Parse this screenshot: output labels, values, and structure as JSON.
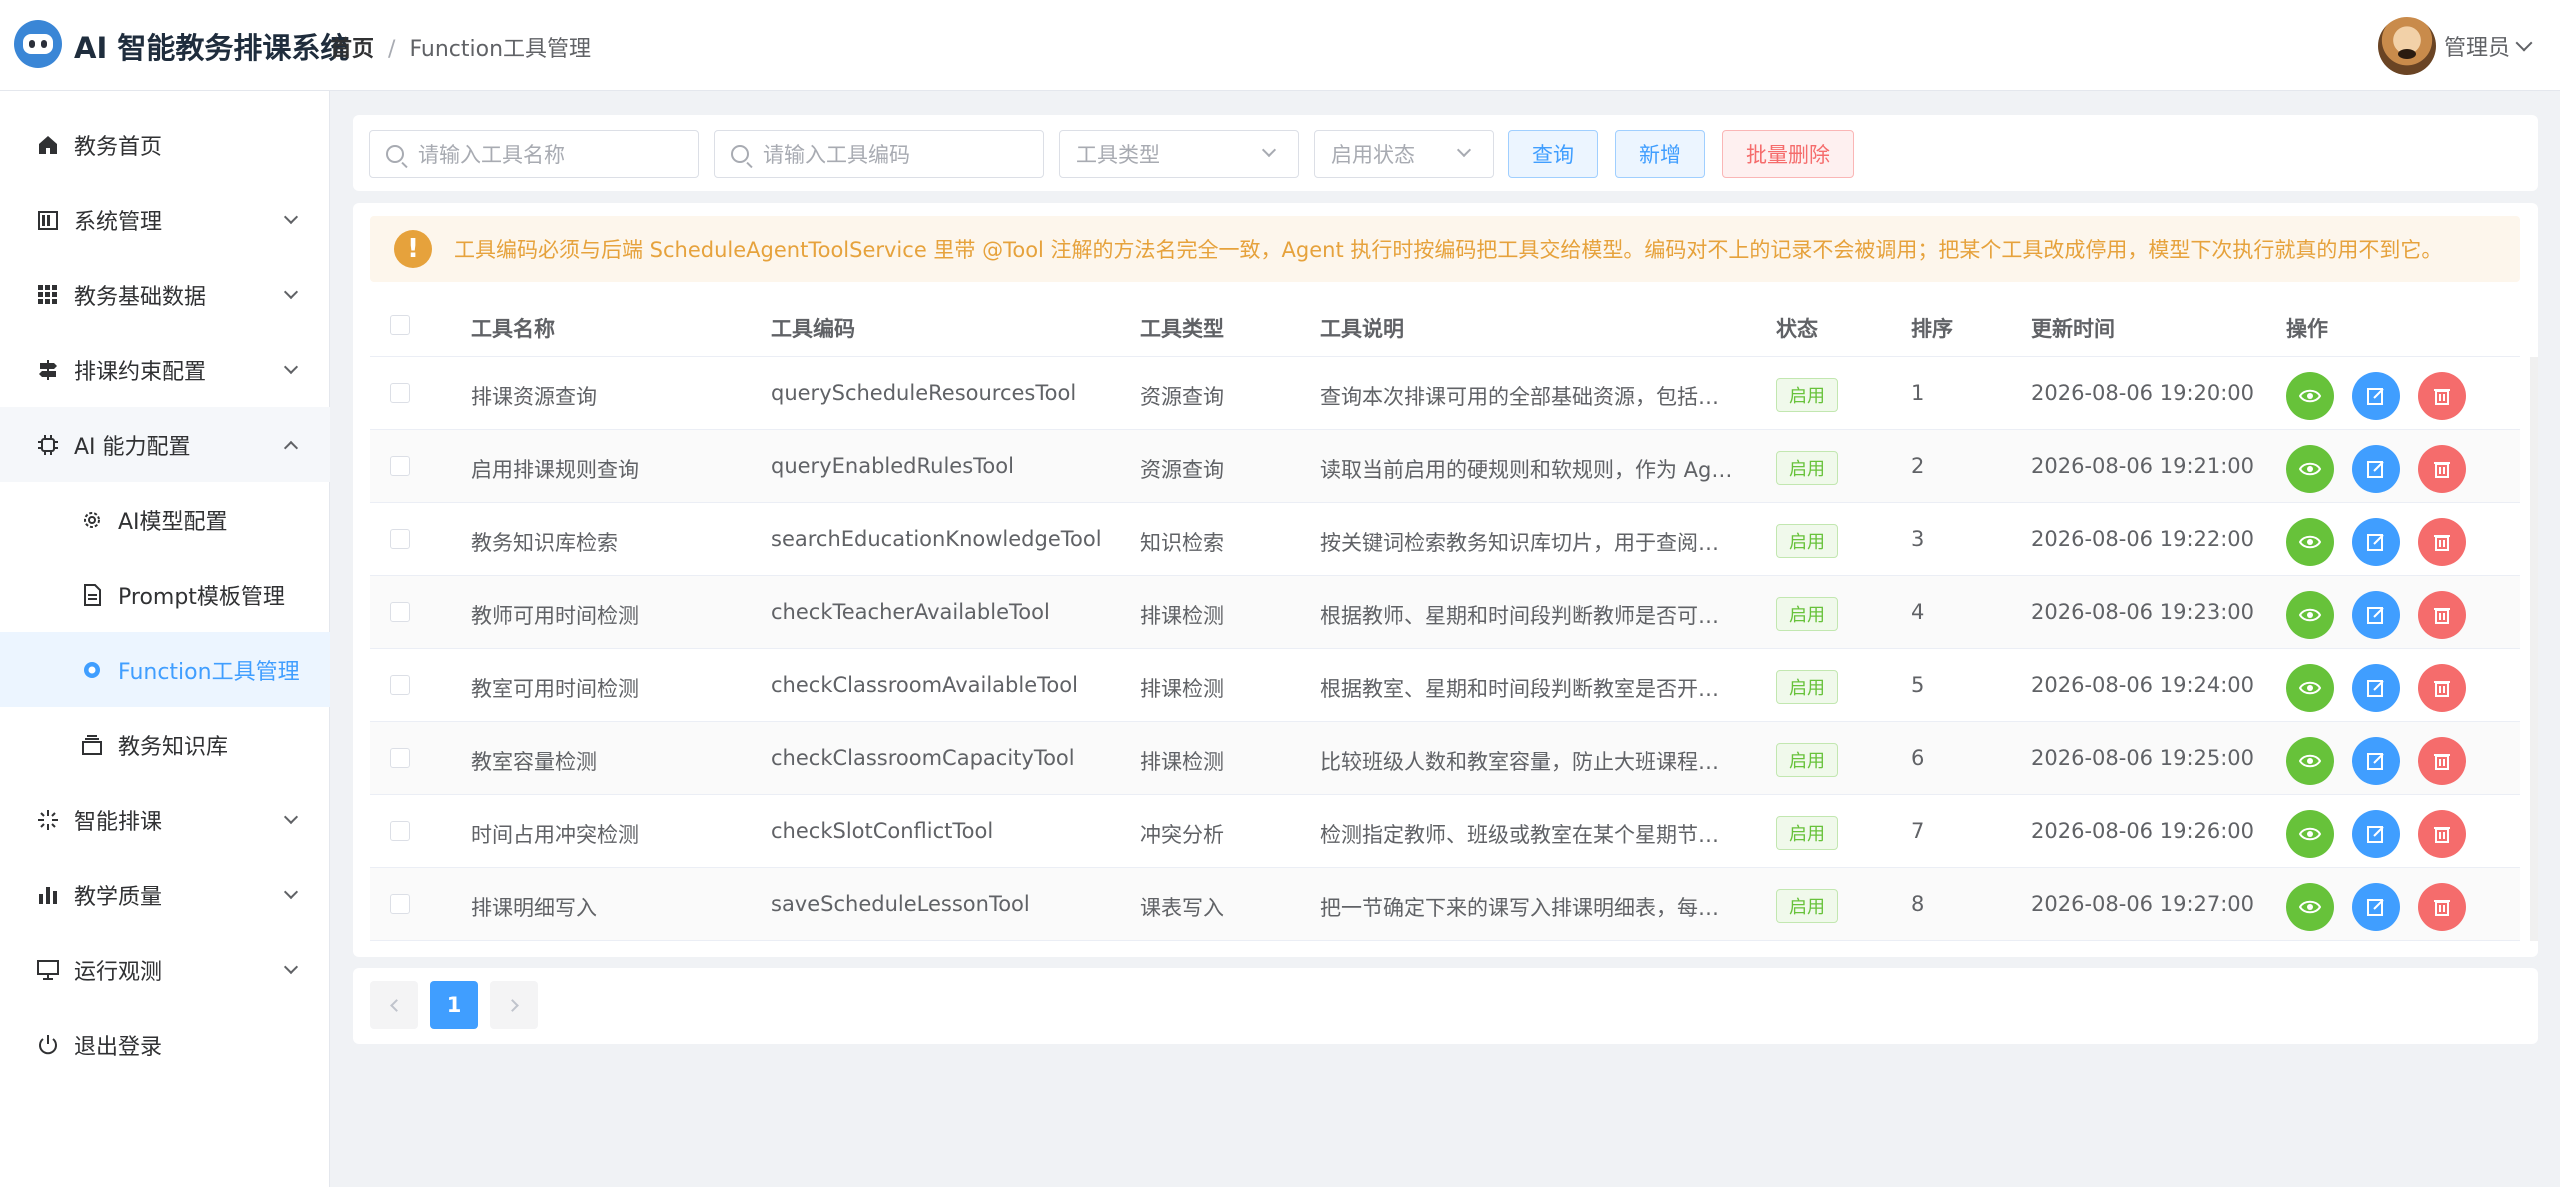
{
  "header": {
    "app_title": "AI 智能教务排课系统",
    "breadcrumb": [
      "首页",
      "Function工具管理"
    ],
    "breadcrumb_sep": "/",
    "user_name": "管理员"
  },
  "sidebar": {
    "items": [
      {
        "label": "教务首页",
        "icon": "home-icon"
      },
      {
        "label": "系统管理",
        "icon": "system-icon"
      },
      {
        "label": "教务基础数据",
        "icon": "grid-icon"
      },
      {
        "label": "排课约束配置",
        "icon": "signpost-icon"
      },
      {
        "label": "AI 能力配置",
        "icon": "chip-icon"
      },
      {
        "label": "AI模型配置",
        "icon": "gear-icon"
      },
      {
        "label": "Prompt模板管理",
        "icon": "document-icon"
      },
      {
        "label": "Function工具管理",
        "icon": "gear-icon"
      },
      {
        "label": "教务知识库",
        "icon": "box-icon"
      },
      {
        "label": "智能排课",
        "icon": "sparkle-icon"
      },
      {
        "label": "教学质量",
        "icon": "bar-chart-icon"
      },
      {
        "label": "运行观测",
        "icon": "monitor-icon"
      },
      {
        "label": "退出登录",
        "icon": "power-icon"
      }
    ]
  },
  "toolbar": {
    "name_placeholder": "请输入工具名称",
    "code_placeholder": "请输入工具编码",
    "type_placeholder": "工具类型",
    "status_placeholder": "启用状态",
    "query_label": "查询",
    "add_label": "新增",
    "batch_delete_label": "批量删除"
  },
  "alert": {
    "icon": "!",
    "text": "工具编码必须与后端 ScheduleAgentToolService 里带 @Tool 注解的方法名完全一致，Agent 执行时按编码把工具交给模型。编码对不上的记录不会被调用；把某个工具改成停用，模型下次执行就真的用不到它。"
  },
  "table": {
    "columns": [
      "工具名称",
      "工具编码",
      "工具类型",
      "工具说明",
      "状态",
      "排序",
      "更新时间",
      "操作"
    ],
    "rows": [
      {
        "name": "排课资源查询",
        "code": "queryScheduleResourcesTool",
        "type": "资源查询",
        "desc": "查询本次排课可用的全部基础资源，包括…",
        "status": "启用",
        "sort": "1",
        "updated": "2026-08-06 19:20:00"
      },
      {
        "name": "启用排课规则查询",
        "code": "queryEnabledRulesTool",
        "type": "资源查询",
        "desc": "读取当前启用的硬规则和软规则，作为 Ag…",
        "status": "启用",
        "sort": "2",
        "updated": "2026-08-06 19:21:00"
      },
      {
        "name": "教务知识库检索",
        "code": "searchEducationKnowledgeTool",
        "type": "知识检索",
        "desc": "按关键词检索教务知识库切片，用于查阅…",
        "status": "启用",
        "sort": "3",
        "updated": "2026-08-06 19:22:00"
      },
      {
        "name": "教师可用时间检测",
        "code": "checkTeacherAvailableTool",
        "type": "排课检测",
        "desc": "根据教师、星期和时间段判断教师是否可…",
        "status": "启用",
        "sort": "4",
        "updated": "2026-08-06 19:23:00"
      },
      {
        "name": "教室可用时间检测",
        "code": "checkClassroomAvailableTool",
        "type": "排课检测",
        "desc": "根据教室、星期和时间段判断教室是否开…",
        "status": "启用",
        "sort": "5",
        "updated": "2026-08-06 19:24:00"
      },
      {
        "name": "教室容量检测",
        "code": "checkClassroomCapacityTool",
        "type": "排课检测",
        "desc": "比较班级人数和教室容量，防止大班课程…",
        "status": "启用",
        "sort": "6",
        "updated": "2026-08-06 19:25:00"
      },
      {
        "name": "时间占用冲突检测",
        "code": "checkSlotConflictTool",
        "type": "冲突分析",
        "desc": "检测指定教师、班级或教室在某个星期节…",
        "status": "启用",
        "sort": "7",
        "updated": "2026-08-06 19:26:00"
      },
      {
        "name": "排课明细写入",
        "code": "saveScheduleLessonTool",
        "type": "课表写入",
        "desc": "把一节确定下来的课写入排课明细表，每…",
        "status": "启用",
        "sort": "8",
        "updated": "2026-08-06 19:27:00"
      }
    ]
  },
  "pagination": {
    "current": "1"
  },
  "colors": {
    "primary": "#409eff",
    "success": "#67c23a",
    "danger": "#f56c6c",
    "warning": "#e6a23c"
  }
}
